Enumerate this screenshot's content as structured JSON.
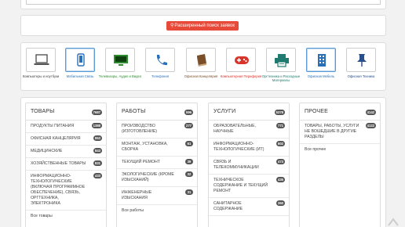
{
  "search": {
    "advanced_button": "Расширенный поиск заявок"
  },
  "categories": [
    {
      "label": "Компьютеры и ноутбуки",
      "icon": "laptop-icon"
    },
    {
      "label": "Мобильная Связь",
      "icon": "mobile-phone-icon"
    },
    {
      "label": "Телевизоры, Аудио и Видео",
      "icon": "tv-icon"
    },
    {
      "label": "Телефония",
      "icon": "phone-handset-icon"
    },
    {
      "label": "Офисная Канцелярия",
      "icon": "book-icon"
    },
    {
      "label": "Компьютерная Периферия",
      "icon": "gamepad-icon"
    },
    {
      "label": "Оргтехника и Расходные Материалы",
      "icon": "printer-icon"
    },
    {
      "label": "Офисная Мебель",
      "icon": "building-icon"
    },
    {
      "label": "Офисная Техника",
      "icon": "pushpin-icon"
    }
  ],
  "columns": [
    {
      "title": "ТОВАРЫ",
      "count": "7687",
      "items": [
        {
          "label": "ПРОДУКТЫ ПИТАНИЯ",
          "count": "1388"
        },
        {
          "label": "ОФИСНАЯ КАНЦЕЛЯРИЯ",
          "count": "853"
        },
        {
          "label": "МЕДИЦИНСКИЕ",
          "count": "843"
        },
        {
          "label": "ХОЗЯЙСТВЕННЫЕ ТОВАРЫ",
          "count": "831"
        },
        {
          "label": "ИНФОРМАЦИОННО-ТЕХНОЛОГИЧЕСКИЕ (ВКЛЮЧАЯ ПРОГРАММНОЕ ОБЕСПЕЧЕНИЕ), СВЯЗЬ, ОРГТЕХНИКА, ЭЛЕКТРОНИКА",
          "count": "433"
        }
      ],
      "all": "Все товары"
    },
    {
      "title": "РАБОТЫ",
      "count": "596",
      "items": [
        {
          "label": "ПРОИЗВОДСТВО (ИЗГОТОВЛЕНИЕ)",
          "count": "277"
        },
        {
          "label": "МОНТАЖ, УСТАНОВКА, СБОРКА",
          "count": "61"
        },
        {
          "label": "ТЕКУЩИЙ РЕМОНТ",
          "count": "39"
        },
        {
          "label": "ЭКОЛОГИЧЕСКИЕ (КРОМЕ ИЗЫСКАНИЙ)",
          "count": "32"
        },
        {
          "label": "ИНЖЕНЕРНЫЕ ИЗЫСКАНИЯ",
          "count": "31"
        }
      ],
      "all": "Все работы"
    },
    {
      "title": "УСЛУГИ",
      "count": "5378",
      "items": [
        {
          "label": "ОБРАЗОВАТЕЛЬНЫЕ, НАУЧНЫЕ",
          "count": "771"
        },
        {
          "label": "ИНФОРМАЦИОННО-ТЕХНОЛОГИЧЕСКИЕ (ИТ)",
          "count": "602"
        },
        {
          "label": "СВЯЗЬ И ТЕЛЕКОММУНИКАЦИИ",
          "count": "473"
        },
        {
          "label": "ТЕХНИЧЕСКОЕ СОДЕРЖАНИЕ И ТЕКУЩИЙ РЕМОНТ",
          "count": "435"
        },
        {
          "label": "САНИТАРНОЕ СОДЕРЖАНИЕ",
          "count": "350"
        }
      ],
      "all": ""
    },
    {
      "title": "ПРОЧЕЕ",
      "count": "4142",
      "items": [
        {
          "label": "ТОВАРЫ, РАБОТЫ, УСЛУГИ НЕ ВОШЕДШИЕ В ДРУГИЕ РАЗДЕЛЫ",
          "count": "4122"
        }
      ],
      "all": "Все прочее"
    }
  ],
  "colors": {
    "accent": "#e84a3a",
    "badge": "#555555",
    "active_border": "#5a9bd5"
  }
}
